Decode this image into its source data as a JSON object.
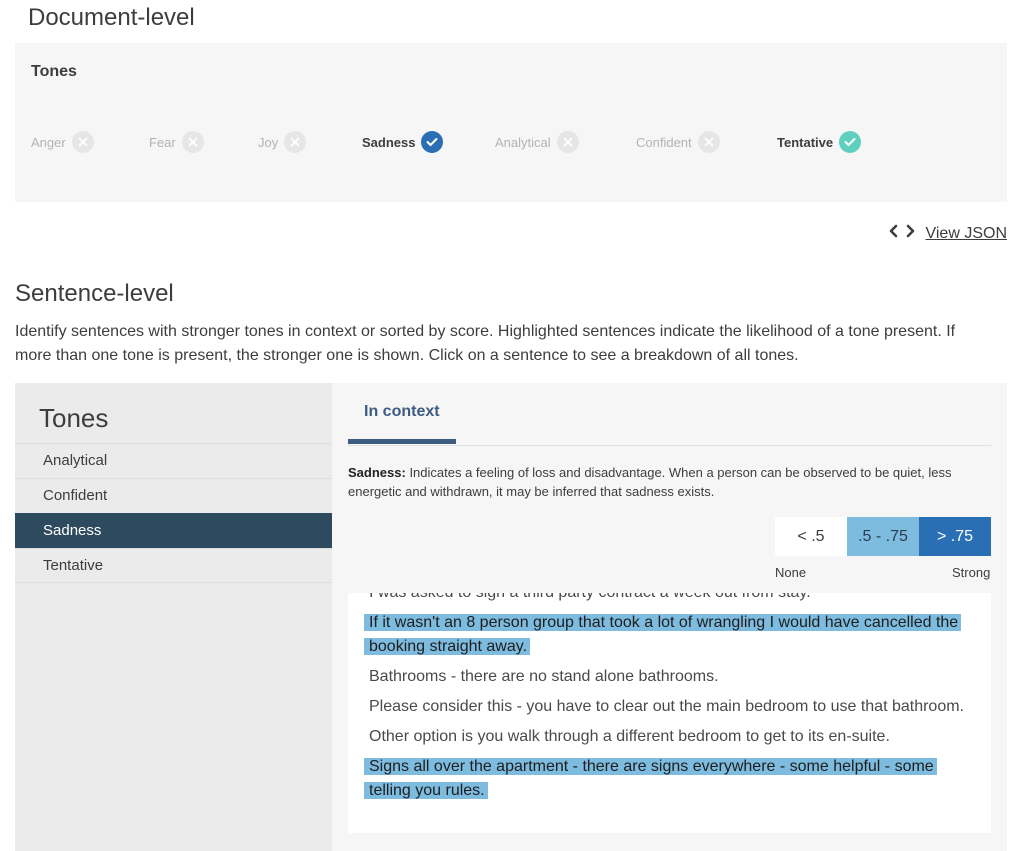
{
  "document_level": {
    "title": "Document-level",
    "panel_title": "Tones",
    "tones": [
      {
        "label": "Anger",
        "state": "off"
      },
      {
        "label": "Fear",
        "state": "off"
      },
      {
        "label": "Joy",
        "state": "off"
      },
      {
        "label": "Sadness",
        "state": "on",
        "color": "#2a6fb4"
      },
      {
        "label": "Analytical",
        "state": "off"
      },
      {
        "label": "Confident",
        "state": "off"
      },
      {
        "label": "Tentative",
        "state": "on",
        "color": "#5fd0c0"
      }
    ],
    "view_json_label": "View JSON"
  },
  "sentence_level": {
    "title": "Sentence-level",
    "description": "Identify sentences with stronger tones in context or sorted by score. Highlighted sentences indicate the likelihood of a tone present. If more than one tone is present, the stronger one is shown. Click on a sentence to see a breakdown of all tones.",
    "sidebar": {
      "title": "Tones",
      "items": [
        {
          "label": "Analytical",
          "selected": false
        },
        {
          "label": "Confident",
          "selected": false
        },
        {
          "label": "Sadness",
          "selected": true
        },
        {
          "label": "Tentative",
          "selected": false
        }
      ]
    },
    "tab_label": "In context",
    "tone_description": {
      "name": "Sadness:",
      "text": "Indicates a feeling of loss and disadvantage. When a person can be observed to be quiet, less energetic and withdrawn, it may be inferred that sadness exists."
    },
    "legend": {
      "low": "< .5",
      "mid": ".5 - .75",
      "high": "> .75",
      "none_label": "None",
      "strong_label": "Strong"
    },
    "sentences": [
      {
        "text": "I was asked to sign a third party contract a week out from stay.",
        "highlight": false
      },
      {
        "text": "If it wasn't an 8 person group that took a lot of wrangling I would have cancelled the booking straight away.",
        "highlight": true
      },
      {
        "text": "Bathrooms - there are no stand alone bathrooms.",
        "highlight": false
      },
      {
        "text": "Please consider this - you have to clear out the main bedroom to use that bathroom.",
        "highlight": false
      },
      {
        "text": "Other option is you walk through a different bedroom to get to its en-suite.",
        "highlight": false
      },
      {
        "text": "Signs all over the apartment - there are signs everywhere - some helpful - some telling you rules.",
        "highlight": true
      }
    ]
  },
  "colors": {
    "selected_sidebar": "#2d4a5e",
    "tab_accent": "#3e5c82",
    "highlight_mid": "#7dbbdf",
    "highlight_strong": "#2a6fb4"
  }
}
